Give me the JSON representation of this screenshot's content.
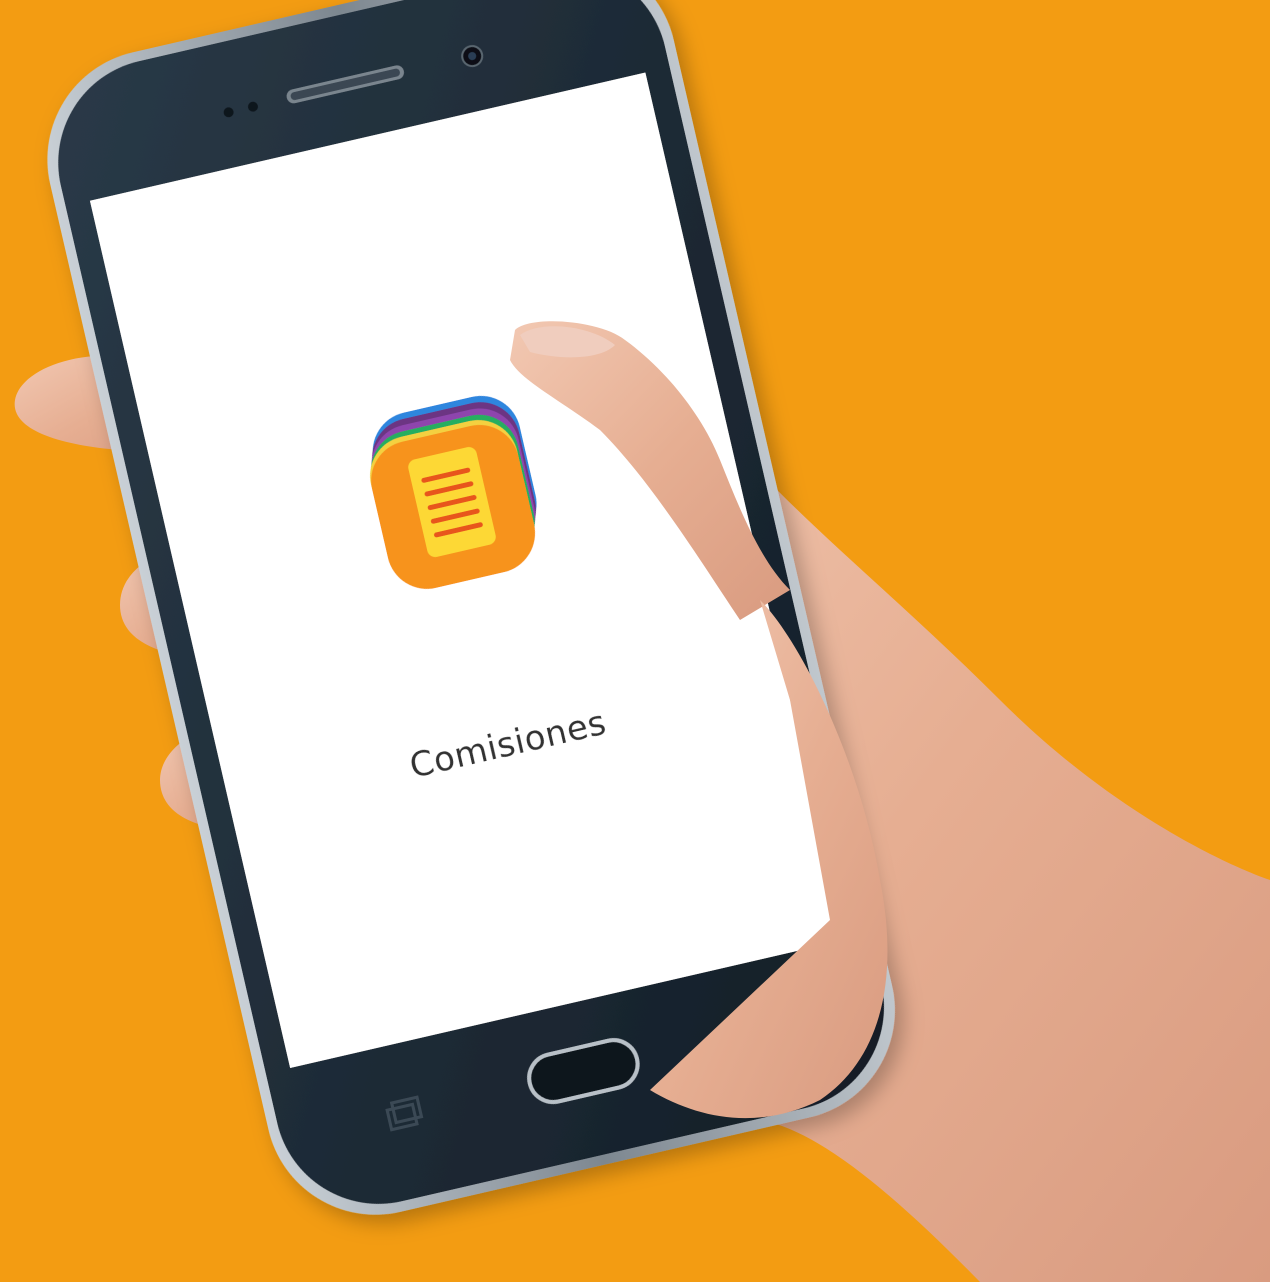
{
  "app": {
    "splash_title": "Comisiones",
    "icon": "stacked-document-icon"
  },
  "colors": {
    "background": "#F39C12",
    "phone_body": "#1d2a36",
    "phone_frame": "#9aa3ab",
    "screen": "#FFFFFF",
    "icon_orange": "#F7931E",
    "icon_document": "#FDD835",
    "icon_lines": "#E8541C",
    "text": "#333333",
    "skin": "#E8B49A"
  }
}
